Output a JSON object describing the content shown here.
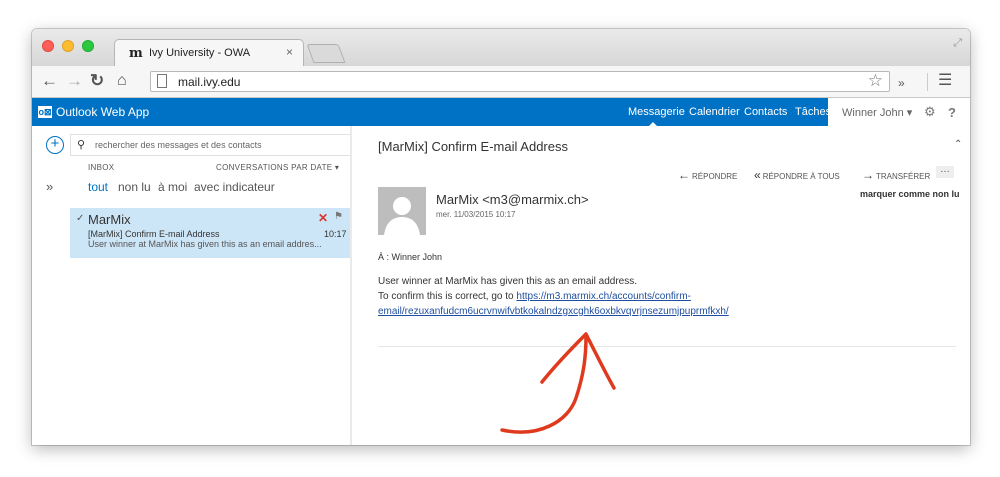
{
  "browser": {
    "tab_favicon": "m",
    "tab_title": "Ivy University - OWA",
    "tab_close": "×",
    "url": "mail.ivy.edu"
  },
  "owa": {
    "app_title": "Outlook Web App",
    "logo_text": "o⊠",
    "nav": {
      "mail": "Messagerie",
      "calendar": "Calendrier",
      "contacts": "Contacts",
      "tasks": "Tâches"
    },
    "user_name": "Winner John ▾",
    "accent_color": "#0072c6"
  },
  "left": {
    "search_placeholder": "rechercher des messages et des contacts",
    "folder_label": "INBOX",
    "sort_label": "CONVERSATIONS PAR DATE ▾",
    "filters": [
      "tout",
      "non lu",
      "à moi",
      "avec indicateur"
    ],
    "expand_glyph": "»",
    "message": {
      "sender": "MarMix",
      "subject": "[MarMix] Confirm E-mail Address",
      "preview": "User winner at MarMix has given this as an email addres...",
      "time": "10:17"
    }
  },
  "read": {
    "subject": "[MarMix] Confirm E-mail Address",
    "actions": {
      "reply": "RÉPONDRE",
      "reply_all": "RÉPONDRE À TOUS",
      "forward": "TRANSFÉRER"
    },
    "mark_unread": "marquer comme non lu",
    "sender": "MarMix <m3@marmix.ch>",
    "date": "mer. 11/03/2015 10:17",
    "to": "À :  Winner John",
    "body": {
      "line1": "User winner at MarMix has given this as an email address.",
      "line2_prefix": "To confirm this is correct, go to ",
      "link_part1": "https://m3.marmix.ch/accounts/confirm-",
      "link_part2": "email/rezuxanfudcm6ucrvnwifvbtkokalndzgxcghk6oxbkvqvrjnsezumjpuprmfkxh/"
    }
  }
}
